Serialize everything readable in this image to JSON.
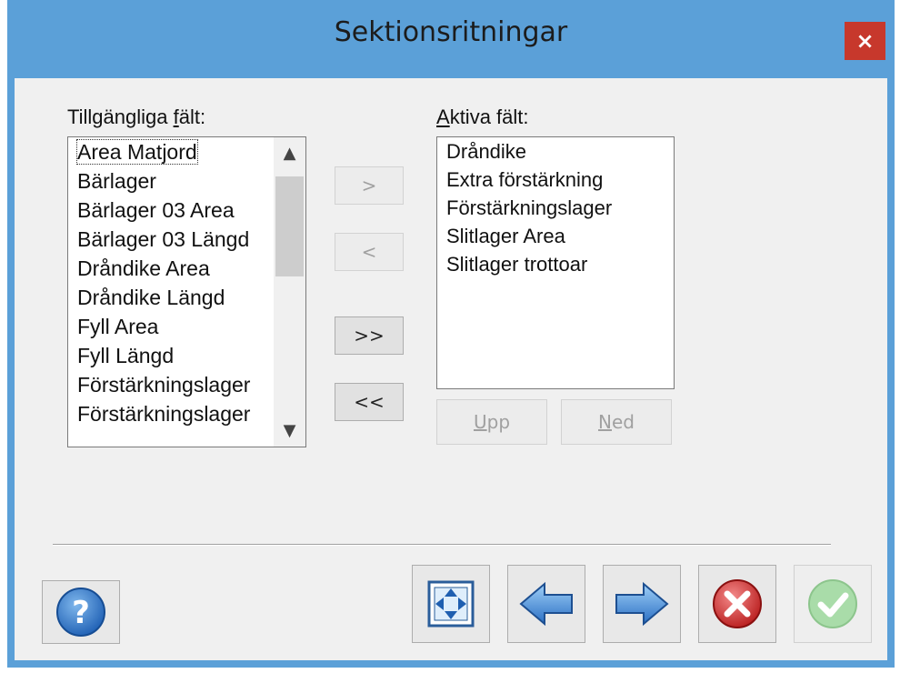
{
  "window": {
    "title": "Sektionsritningar",
    "close_label": "×"
  },
  "available": {
    "label_prefix": "Tillgängliga ",
    "label_mnemonic": "f",
    "label_suffix": "ält:",
    "items": [
      "Area Matjord",
      "Bärlager",
      "Bärlager 03 Area",
      "Bärlager 03 Längd",
      "Dråndike Area",
      "Dråndike Längd",
      "Fyll Area",
      "Fyll Längd",
      "Förstärkningslager",
      "Förstärkningslager"
    ],
    "scroll_up": "▲",
    "scroll_down": "▼"
  },
  "active": {
    "label_mnemonic": "A",
    "label_rest": "ktiva fält:",
    "items": [
      "Dråndike",
      "Extra förstärkning",
      "Förstärkningslager",
      "Slitlager Area",
      "Slitlager trottoar"
    ]
  },
  "transfer": {
    "add_label": ">",
    "remove_label": "<",
    "add_all_label": ">>",
    "remove_all_label": "<<"
  },
  "order": {
    "up_mnemonic": "U",
    "up_rest": "pp",
    "down_mnemonic": "N",
    "down_rest": "ed"
  },
  "footer": {
    "help_icon": "question-mark",
    "fit_icon": "fit-window",
    "back_icon": "arrow-left",
    "next_icon": "arrow-right",
    "cancel_icon": "red-x",
    "ok_icon": "green-check"
  }
}
